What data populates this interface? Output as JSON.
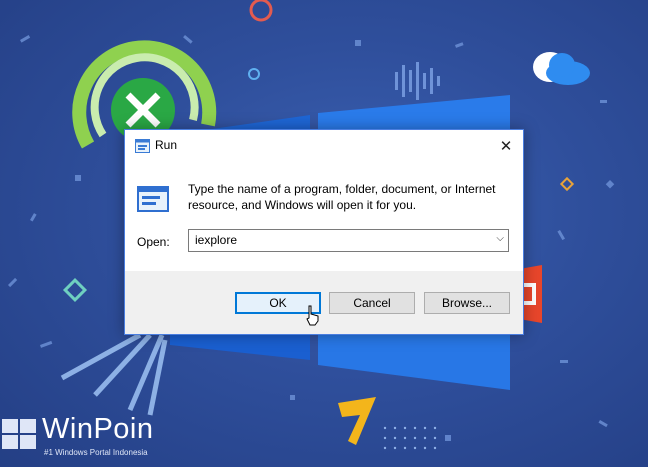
{
  "dialog": {
    "title": "Run",
    "description": "Type the name of a program, folder, document, or Internet resource, and Windows will open it for you.",
    "open_label": "Open:",
    "open_value": "iexplore",
    "buttons": {
      "ok": "OK",
      "cancel": "Cancel",
      "browse": "Browse..."
    }
  },
  "watermark": {
    "title": "WinPoin",
    "subtitle": "#1 Windows Portal Indonesia"
  },
  "colors": {
    "desktop": "#2f4f9c",
    "accent": "#0078d7",
    "titlebar": "#ffffff"
  },
  "icons": [
    "run-icon",
    "close-icon",
    "chevron-down-icon",
    "pointer-cursor-icon",
    "windows-logo-icon",
    "xbox-icon",
    "onedrive-cloud-icon",
    "office-icon",
    "plex-icon"
  ]
}
